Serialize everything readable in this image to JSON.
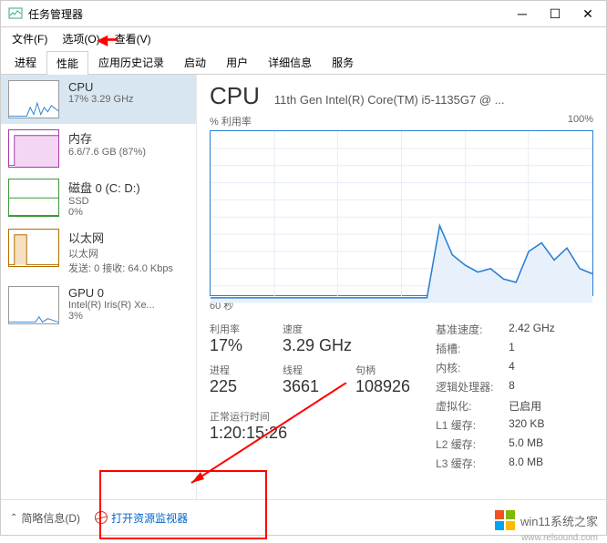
{
  "titlebar": {
    "title": "任务管理器"
  },
  "menu": {
    "file": "文件(F)",
    "options": "选项(O)",
    "view": "查看(V)"
  },
  "tabs": {
    "processes": "进程",
    "performance": "性能",
    "app_history": "应用历史记录",
    "startup": "启动",
    "users": "用户",
    "details": "详细信息",
    "services": "服务"
  },
  "sidebar": {
    "cpu": {
      "title": "CPU",
      "sub": "17%  3.29 GHz"
    },
    "mem": {
      "title": "内存",
      "sub": "6.6/7.6 GB (87%)"
    },
    "disk": {
      "title": "磁盘 0 (C: D:)",
      "sub1": "SSD",
      "sub2": "0%"
    },
    "eth": {
      "title": "以太网",
      "sub1": "以太网",
      "sub2": "发送: 0 接收: 64.0 Kbps"
    },
    "gpu": {
      "title": "GPU 0",
      "sub1": "Intel(R) Iris(R) Xe...",
      "sub2": "3%"
    }
  },
  "main": {
    "title": "CPU",
    "subtitle": "11th Gen Intel(R) Core(TM) i5-1135G7 @ ...",
    "chart_ylabel": "% 利用率",
    "chart_ymax": "100%",
    "chart_xlabel": "60 秒",
    "stats": {
      "util_label": "利用率",
      "util_val": "17%",
      "speed_label": "速度",
      "speed_val": "3.29 GHz",
      "proc_label": "进程",
      "proc_val": "225",
      "threads_label": "线程",
      "threads_val": "3661",
      "handles_label": "句柄",
      "handles_val": "108926",
      "uptime_label": "正常运行时间",
      "uptime_val": "1:20:15:26"
    },
    "right": {
      "base_label": "基准速度:",
      "base_val": "2.42 GHz",
      "sockets_label": "插槽:",
      "sockets_val": "1",
      "cores_label": "内核:",
      "cores_val": "4",
      "lp_label": "逻辑处理器:",
      "lp_val": "8",
      "virt_label": "虚拟化:",
      "virt_val": "已启用",
      "l1_label": "L1 缓存:",
      "l1_val": "320 KB",
      "l2_label": "L2 缓存:",
      "l2_val": "5.0 MB",
      "l3_label": "L3 缓存:",
      "l3_val": "8.0 MB"
    }
  },
  "footer": {
    "brief": "简略信息(D)",
    "resmon": "打开资源监视器"
  },
  "watermark": {
    "main": "win11系统之家",
    "sub": "www.relsound.com"
  },
  "chart_data": {
    "type": "line",
    "title": "CPU % 利用率",
    "ylabel": "% 利用率",
    "ylim": [
      0,
      100
    ],
    "xlabel": "60 秒",
    "x_seconds_ago": [
      60,
      58,
      56,
      54,
      52,
      50,
      48,
      46,
      44,
      42,
      40,
      38,
      36,
      34,
      32,
      30,
      28,
      26,
      24,
      22,
      20,
      18,
      16,
      14,
      12,
      10,
      8,
      6,
      4,
      2,
      0
    ],
    "values": [
      3,
      3,
      3,
      3,
      3,
      3,
      3,
      3,
      3,
      3,
      3,
      3,
      3,
      3,
      3,
      3,
      3,
      3,
      45,
      28,
      22,
      18,
      20,
      14,
      12,
      30,
      35,
      25,
      32,
      20,
      17
    ]
  }
}
